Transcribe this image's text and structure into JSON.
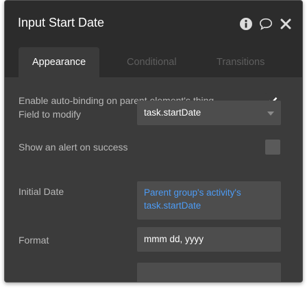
{
  "window": {
    "title": "Input Start Date",
    "icons": [
      "info-icon",
      "comment-icon",
      "close-icon"
    ]
  },
  "tabs": [
    {
      "label": "Appearance",
      "active": true
    },
    {
      "label": "Conditional",
      "active": false
    },
    {
      "label": "Transitions",
      "active": false
    }
  ],
  "properties": {
    "auto_binding": {
      "label": "Enable auto-binding on parent element's thing",
      "checked": true
    },
    "field_to_modify": {
      "label": "Field to modify",
      "value": "task.startDate"
    },
    "alert_on_success": {
      "label": "Show an alert on success",
      "checked": false
    },
    "initial_date": {
      "label": "Initial Date",
      "value_line1": "Parent group's activity's",
      "value_line2": "task.startDate"
    },
    "format": {
      "label": "Format",
      "value": "mmm dd, yyyy"
    }
  },
  "colors": {
    "panel_bg": "#3b3b3b",
    "titlebar_bg": "#2c2c2c",
    "field_bg": "#4d4d4d",
    "dynamic_text": "#4d9cf6"
  }
}
